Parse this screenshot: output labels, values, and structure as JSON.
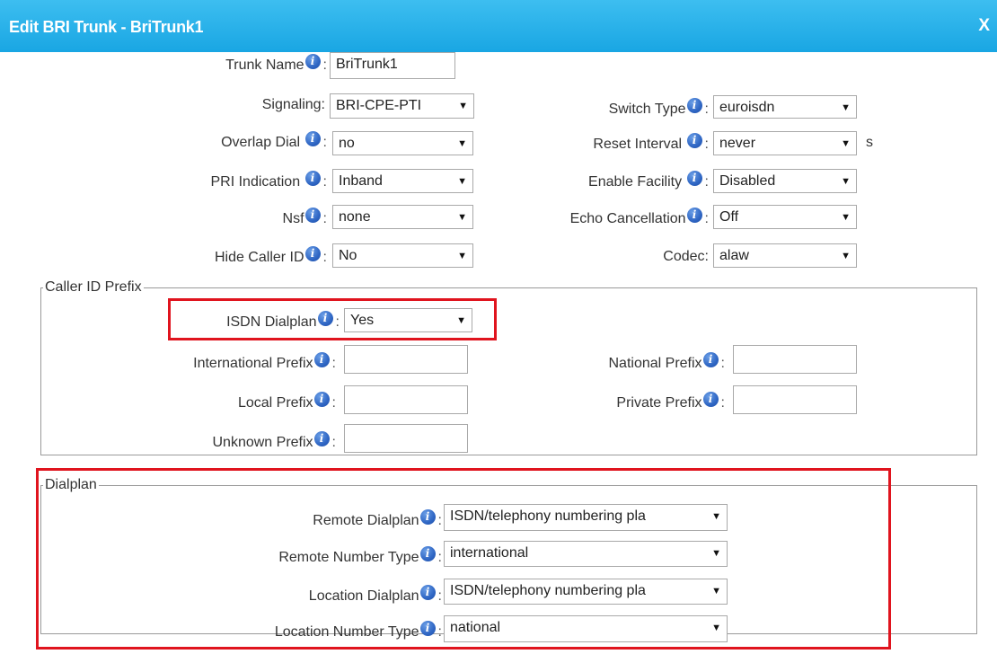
{
  "dialog": {
    "title": "Edit BRI Trunk - BriTrunk1",
    "close": "X"
  },
  "fields": {
    "trunk_name": {
      "label": "Trunk Name",
      "value": "BriTrunk1"
    },
    "signaling": {
      "label": "Signaling:",
      "value": "BRI-CPE-PTI"
    },
    "switch_type": {
      "label": "Switch Type",
      "value": "euroisdn"
    },
    "overlap_dial": {
      "label": "Overlap Dial ",
      "value": "no"
    },
    "reset_interval": {
      "label": "Reset Interval ",
      "value": "never",
      "unit": "s"
    },
    "pri_indication": {
      "label": "PRI Indication ",
      "value": "Inband"
    },
    "enable_facility": {
      "label": "Enable Facility ",
      "value": "Disabled"
    },
    "nsf": {
      "label": "Nsf",
      "value": "none"
    },
    "echo_cancellation": {
      "label": "Echo Cancellation",
      "value": "Off"
    },
    "hide_caller_id": {
      "label": "Hide Caller ID",
      "value": "No"
    },
    "codec": {
      "label": "Codec:",
      "value": "alaw"
    }
  },
  "caller_id_prefix": {
    "legend": "Caller ID Prefix",
    "isdn_dialplan": {
      "label": "ISDN Dialplan",
      "value": "Yes"
    },
    "international_prefix": {
      "label": "International Prefix",
      "value": ""
    },
    "national_prefix": {
      "label": "National Prefix",
      "value": ""
    },
    "local_prefix": {
      "label": "Local Prefix",
      "value": ""
    },
    "private_prefix": {
      "label": "Private Prefix",
      "value": ""
    },
    "unknown_prefix": {
      "label": "Unknown Prefix",
      "value": ""
    }
  },
  "dialplan": {
    "legend": "Dialplan",
    "remote_dialplan": {
      "label": "Remote Dialplan",
      "value": "ISDN/telephony numbering pla"
    },
    "remote_number_type": {
      "label": "Remote Number Type",
      "value": "international"
    },
    "location_dialplan": {
      "label": "Location Dialplan",
      "value": "ISDN/telephony numbering pla"
    },
    "location_number_type": {
      "label": "Location Number Type",
      "value": "national"
    }
  },
  "icons": {
    "info": "info-icon",
    "close": "close-icon",
    "dropdown": "chevron-down-icon"
  },
  "colors": {
    "titlebar": "#1ea9e6",
    "highlight": "#e0141e"
  }
}
